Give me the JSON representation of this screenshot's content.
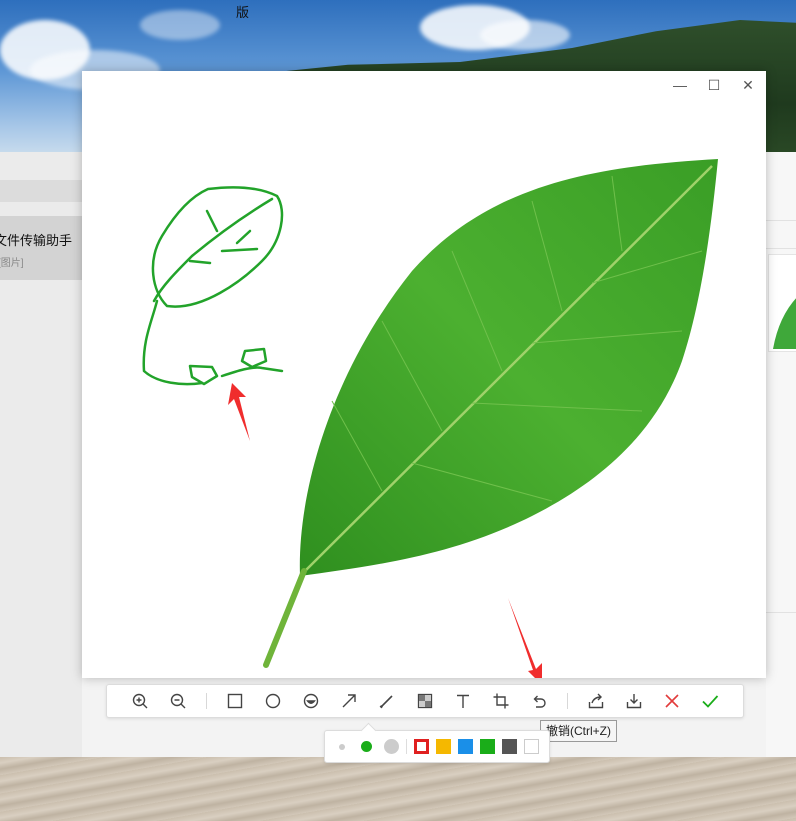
{
  "desktop": {
    "title_char": "版"
  },
  "chat_app": {
    "contact_name": "文件传输助手",
    "contact_sub": "[图片]"
  },
  "viewer": {
    "window_controls": {
      "minimize": "—",
      "maximize": "☐",
      "close": "✕"
    },
    "annotation_color": "#22a32a",
    "arrow_color": "#f02d2d"
  },
  "toolbar": {
    "tools": [
      "zoom-in-icon",
      "zoom-out-icon",
      "rectangle-icon",
      "ellipse-icon",
      "emoji-icon",
      "arrow-icon",
      "pen-icon",
      "mosaic-icon",
      "text-icon",
      "crop-icon",
      "undo-icon",
      "share-icon",
      "download-icon",
      "close-icon",
      "confirm-icon"
    ],
    "tooltip": "撤销(Ctrl+Z)"
  },
  "palette": {
    "selected_size": "medium",
    "colors": [
      "#e02020",
      "#f5b800",
      "#1a8fe8",
      "#1aad19",
      "#555555",
      "#ffffff"
    ],
    "selected_color": "#e02020"
  }
}
